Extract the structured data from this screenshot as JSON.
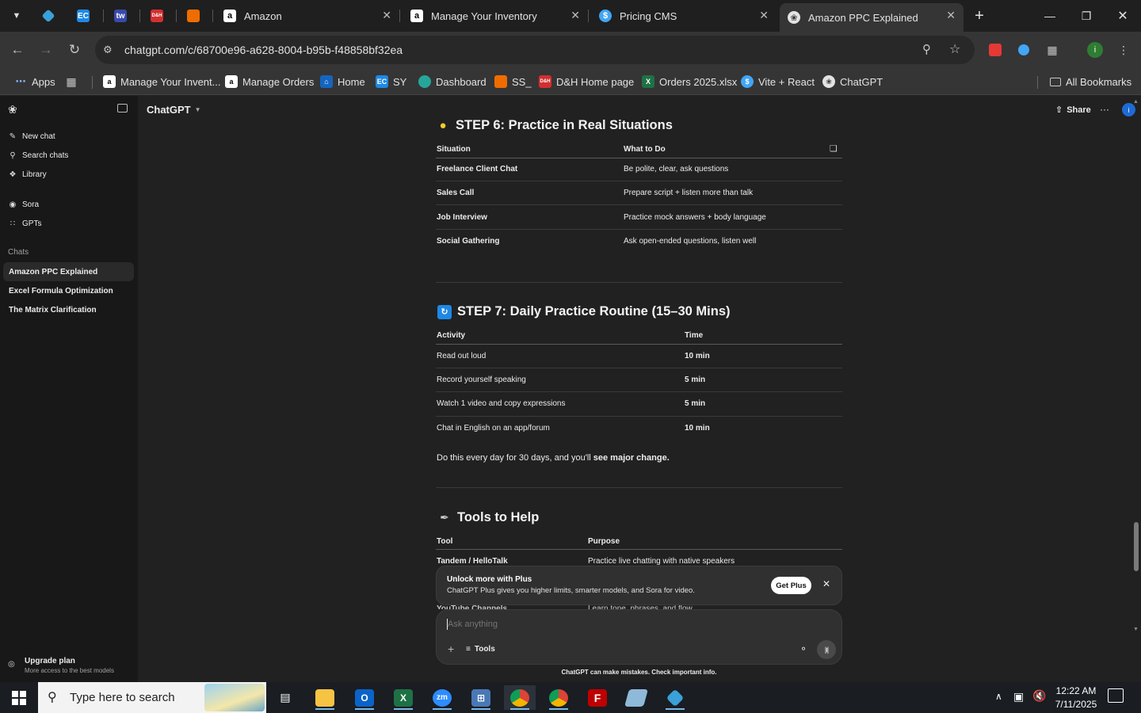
{
  "browser": {
    "pinned_tabs": [
      {
        "icon": "diamond-favicon-icon",
        "color": "#3aa0d8"
      },
      {
        "icon": "ec-favicon-icon",
        "text": "EC",
        "color": "#1e88e5"
      },
      {
        "icon": "tw-favicon-icon",
        "text": "tw",
        "color": "#3949ab"
      },
      {
        "icon": "dh-favicon-icon",
        "text": "D&H",
        "color": "#d32f2f"
      },
      {
        "icon": "stack-favicon-icon",
        "color": "#ef6c00"
      }
    ],
    "tabs": [
      {
        "title": "Amazon",
        "icon": "amazon-favicon-icon",
        "active": false
      },
      {
        "title": "Manage Your Inventory",
        "icon": "amazon-favicon-icon",
        "active": false
      },
      {
        "title": "Pricing CMS",
        "icon": "dollar-favicon-icon",
        "active": false
      },
      {
        "title": "Amazon PPC Explained",
        "icon": "chatgpt-favicon-icon",
        "active": true
      }
    ],
    "url": "chatgpt.com/c/68700e96-a628-8004-b95b-f48858bf32ea",
    "bookmarks": [
      {
        "label": "Apps",
        "icon": "apps-grid-icon"
      },
      {
        "label": "",
        "icon": "tab-groups-icon"
      },
      {
        "label": "Manage Your Invent...",
        "icon": "amazon-favicon-icon"
      },
      {
        "label": "Manage Orders",
        "icon": "amazon-favicon-icon"
      },
      {
        "label": "Home",
        "icon": "home-favicon-icon"
      },
      {
        "label": "SY",
        "icon": "ec-favicon-icon"
      },
      {
        "label": "Dashboard",
        "icon": "dashboard-favicon-icon"
      },
      {
        "label": "SS_",
        "icon": "stack-favicon-icon"
      },
      {
        "label": "D&H Home page",
        "icon": "dh-favicon-icon"
      },
      {
        "label": "Orders 2025.xlsx",
        "icon": "excel-favicon-icon"
      },
      {
        "label": "Vite + React",
        "icon": "dollar-favicon-icon"
      },
      {
        "label": "ChatGPT",
        "icon": "chatgpt-favicon-icon"
      }
    ],
    "all_bookmarks": "All Bookmarks",
    "profile_initial": "i"
  },
  "sidebar": {
    "nav": [
      {
        "label": "New chat",
        "icon": "new-chat-icon"
      },
      {
        "label": "Search chats",
        "icon": "search-icon"
      },
      {
        "label": "Library",
        "icon": "library-icon"
      }
    ],
    "apps": [
      {
        "label": "Sora",
        "icon": "sora-icon"
      },
      {
        "label": "GPTs",
        "icon": "gpts-icon"
      }
    ],
    "chats_header": "Chats",
    "chats": [
      {
        "label": "Amazon PPC Explained",
        "active": true
      },
      {
        "label": "Excel Formula Optimization",
        "active": false
      },
      {
        "label": "The Matrix Clarification",
        "active": false
      }
    ],
    "upgrade_title": "Upgrade plan",
    "upgrade_sub": "More access to the best models"
  },
  "header": {
    "model": "ChatGPT",
    "share": "Share",
    "more": "···",
    "avatar": "i"
  },
  "content": {
    "step6": {
      "title": "STEP 6: Practice in Real Situations",
      "icon": "lightbulb-icon",
      "headers": [
        "Situation",
        "What to Do"
      ],
      "rows": [
        [
          "Freelance Client Chat",
          "Be polite, clear, ask questions"
        ],
        [
          "Sales Call",
          "Prepare script + listen more than talk"
        ],
        [
          "Job Interview",
          "Practice mock answers + body language"
        ],
        [
          "Social Gathering",
          "Ask open-ended questions, listen well"
        ]
      ]
    },
    "step7": {
      "title": "STEP 7: Daily Practice Routine (15–30 Mins)",
      "icon": "repeat-icon",
      "headers": [
        "Activity",
        "Time"
      ],
      "rows": [
        [
          "Read out loud",
          "10 min"
        ],
        [
          "Record yourself speaking",
          "5 min"
        ],
        [
          "Watch 1 video and copy expressions",
          "5 min"
        ],
        [
          "Chat in English on an app/forum",
          "10 min"
        ]
      ],
      "note_prefix": "Do this every day for 30 days, and you'll ",
      "note_bold": "see major change."
    },
    "tools": {
      "title": "Tools to Help",
      "icon": "wrench-icon",
      "headers": [
        "Tool",
        "Purpose"
      ],
      "rows": [
        [
          "Tandem / HelloTalk",
          "Practice live chatting with native speakers"
        ],
        [
          "YouTube Channels",
          "Learn tone, phrases, and flow"
        ]
      ]
    }
  },
  "upsell": {
    "title": "Unlock more with Plus",
    "body": "ChatGPT Plus gives you higher limits, smarter models, and Sora for video.",
    "button": "Get Plus"
  },
  "composer": {
    "placeholder": "Ask anything",
    "tools": "Tools"
  },
  "disclaimer": "ChatGPT can make mistakes. Check important info.",
  "taskbar": {
    "search_placeholder": "Type here to search",
    "time": "12:22 AM",
    "date": "7/11/2025"
  }
}
